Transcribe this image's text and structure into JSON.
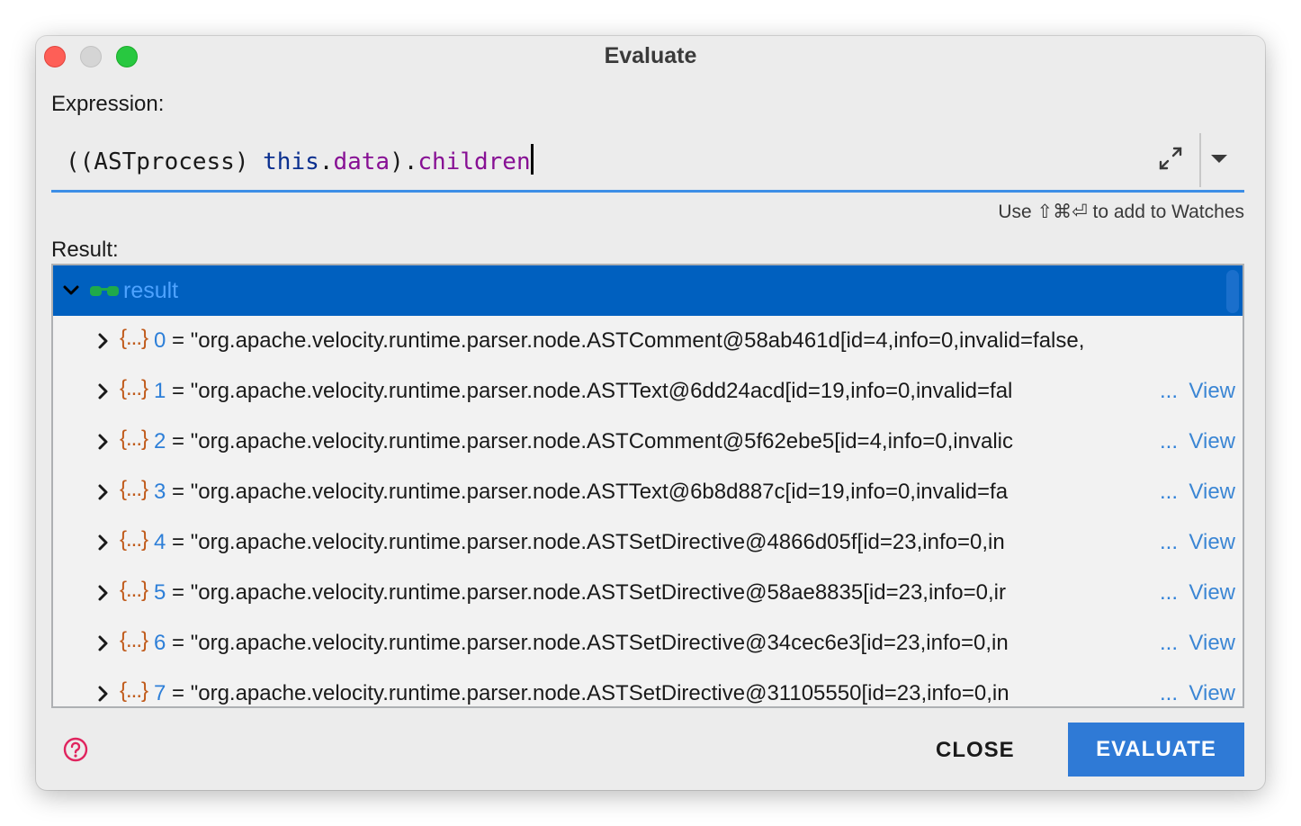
{
  "window": {
    "title": "Evaluate"
  },
  "expression": {
    "label": "Expression:",
    "part_cast": "((ASTprocess) ",
    "part_this": "this",
    "part_dot1": ".",
    "part_data": "data",
    "part_close": ").",
    "part_children": "children",
    "hint": "Use ⇧⌘⏎ to add to Watches"
  },
  "result": {
    "label": "Result:",
    "root_label": "result",
    "items": [
      {
        "index": "0",
        "text": " = \"org.apache.velocity.runtime.parser.node.ASTComment@58ab461d[id=4,info=0,invalid=false,",
        "truncated": false
      },
      {
        "index": "1",
        "text": " = \"org.apache.velocity.runtime.parser.node.ASTText@6dd24acd[id=19,info=0,invalid=fal",
        "truncated": true
      },
      {
        "index": "2",
        "text": " = \"org.apache.velocity.runtime.parser.node.ASTComment@5f62ebe5[id=4,info=0,invalic",
        "truncated": true
      },
      {
        "index": "3",
        "text": " = \"org.apache.velocity.runtime.parser.node.ASTText@6b8d887c[id=19,info=0,invalid=fa",
        "truncated": true
      },
      {
        "index": "4",
        "text": " = \"org.apache.velocity.runtime.parser.node.ASTSetDirective@4866d05f[id=23,info=0,in",
        "truncated": true
      },
      {
        "index": "5",
        "text": " = \"org.apache.velocity.runtime.parser.node.ASTSetDirective@58ae8835[id=23,info=0,ir",
        "truncated": true
      },
      {
        "index": "6",
        "text": " = \"org.apache.velocity.runtime.parser.node.ASTSetDirective@34cec6e3[id=23,info=0,in",
        "truncated": true
      },
      {
        "index": "7",
        "text": " = \"org.apache.velocity.runtime.parser.node.ASTSetDirective@31105550[id=23,info=0,in",
        "truncated": true
      }
    ],
    "ellipsis": "...",
    "view_label": "View",
    "object_icon_glyph": "{...}"
  },
  "buttons": {
    "close": "CLOSE",
    "evaluate": "EVALUATE"
  },
  "icons": {
    "help": "help-icon",
    "expand": "expand-icon",
    "dropdown": "dropdown-icon",
    "watch": "glasses-icon",
    "object": "object-icon"
  },
  "colors": {
    "selection": "#0060bf",
    "accent": "#2f7ad6",
    "index": "#2d7fd8",
    "keyword": "#0a2f8f",
    "field": "#871094",
    "object_icon": "#c05a1a",
    "help": "#e0245e",
    "glasses": "#1faa4b"
  }
}
